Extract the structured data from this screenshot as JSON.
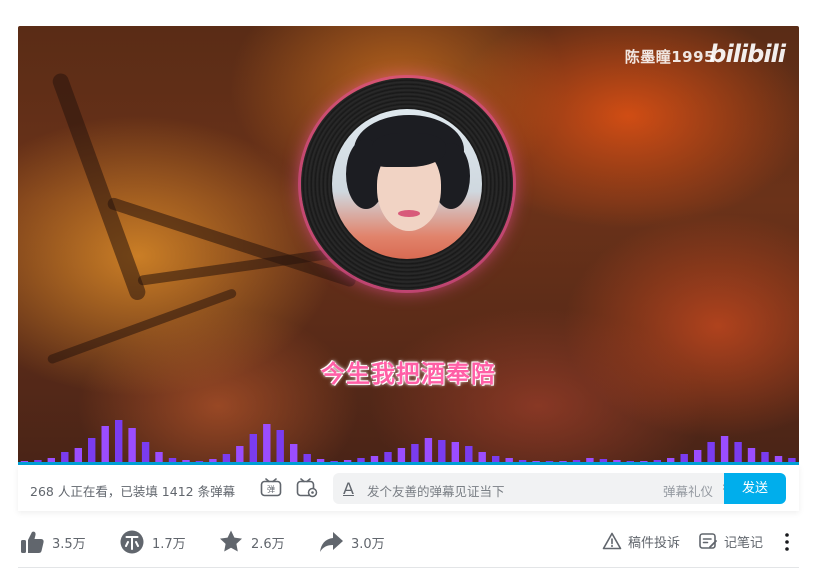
{
  "video": {
    "uploader_watermark": "陈墨瞳1995",
    "logo_text": "bilibili",
    "lyric": "今生我把酒奉陪"
  },
  "danmaku_bar": {
    "viewers_text": "268 人正在看，已装填 1412 条弹幕",
    "input_icon": "text-style-icon",
    "input_placeholder": "发个友善的弹幕见证当下",
    "etiquette_label": "弹幕礼仪",
    "send_label": "发送",
    "accent_color": "#00aeec"
  },
  "actions": {
    "like_count": "3.5万",
    "coin_count": "1.7万",
    "favorite_count": "2.6万",
    "share_count": "3.0万",
    "report_label": "稿件投诉",
    "notes_label": "记笔记"
  }
}
